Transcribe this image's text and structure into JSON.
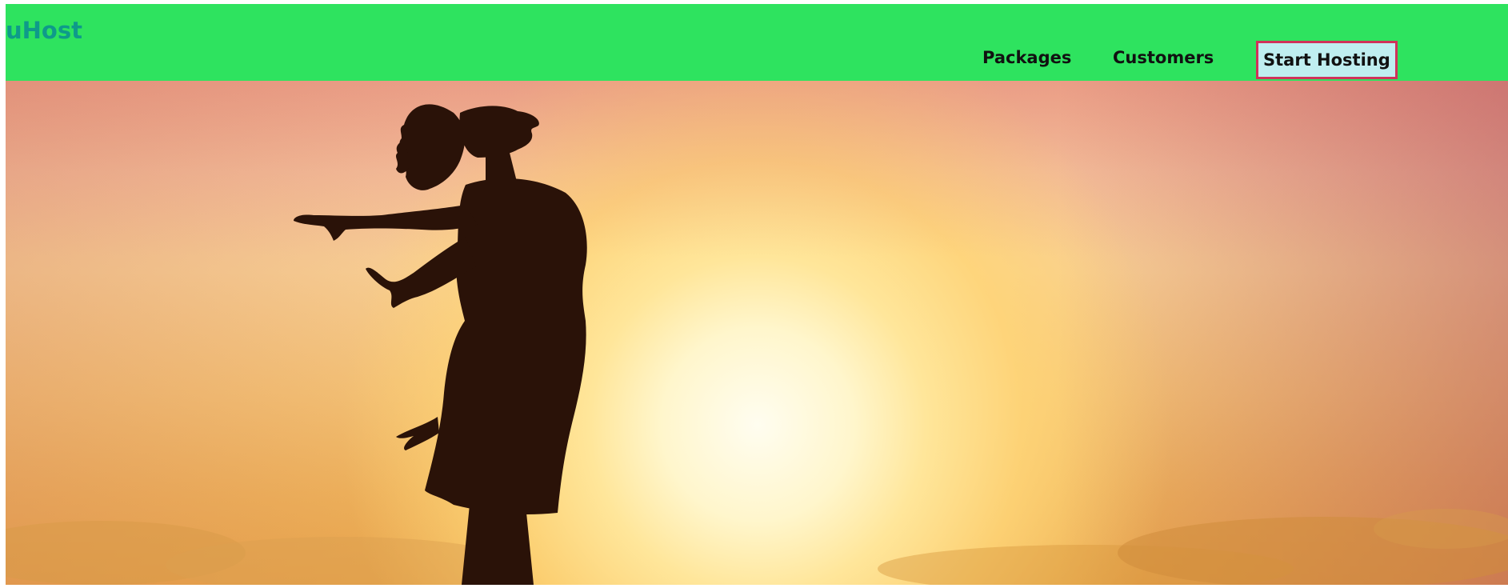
{
  "header": {
    "brand": "uHost",
    "background_color": "#2ee35f",
    "brand_color": "#0e9a8a",
    "nav": {
      "packages": "Packages",
      "customers": "Customers",
      "start_hosting": "Start Hosting"
    },
    "cta_background": "#bfeef0",
    "cta_border": "#d0325a"
  },
  "hero": {
    "image_subject": "woman-silhouette-sunset"
  }
}
